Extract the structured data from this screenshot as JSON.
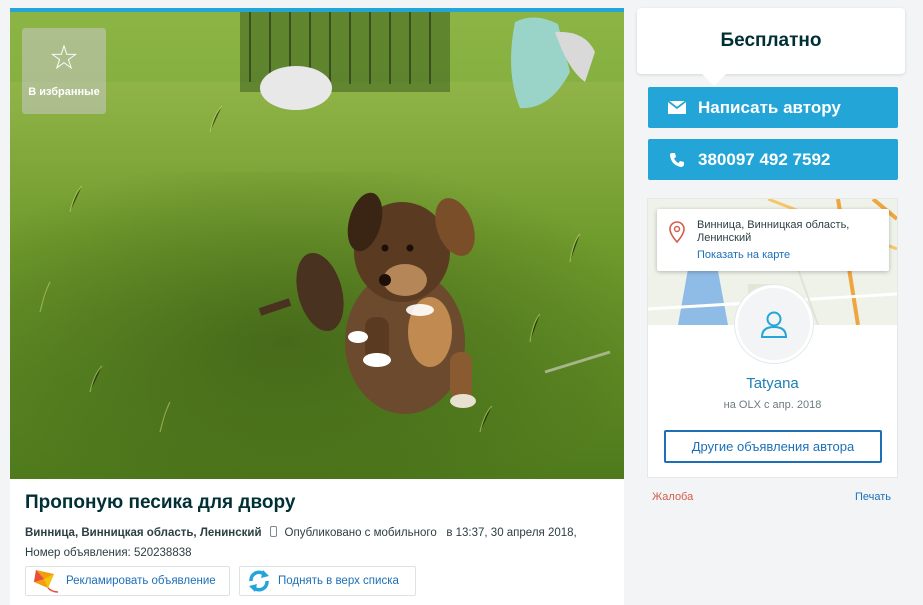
{
  "favorites": {
    "label": "В избранные"
  },
  "ad": {
    "title": "Пропоную песика для двору",
    "location": "Винница, Винницкая область, Ленинский",
    "published": "Опубликовано с мобильного",
    "datetime": "в 13:37, 30 апреля 2018, Номер объявления: 520238838"
  },
  "actions": {
    "promote": "Рекламировать объявление",
    "raise": "Поднять в верх списка"
  },
  "price": "Бесплатно",
  "contact": {
    "write_label": "Написать автору",
    "phone": "380097 492 7592"
  },
  "map": {
    "address": "Винница, Винницкая область, Ленинский",
    "show_on_map": "Показать на карте"
  },
  "seller": {
    "name": "Tatyana",
    "since": "на OLX с апр. 2018",
    "other_ads": "Другие объявления автора"
  },
  "footer": {
    "complaint": "Жалоба",
    "print": "Печать"
  },
  "colors": {
    "accent": "#23a5d8",
    "link": "#1d6fb8",
    "complaint": "#d35d4c"
  },
  "icons": [
    "star-icon",
    "mobile-icon",
    "kite-icon",
    "refresh-icon",
    "envelope-icon",
    "phone-icon",
    "map-pin-icon",
    "user-icon"
  ]
}
